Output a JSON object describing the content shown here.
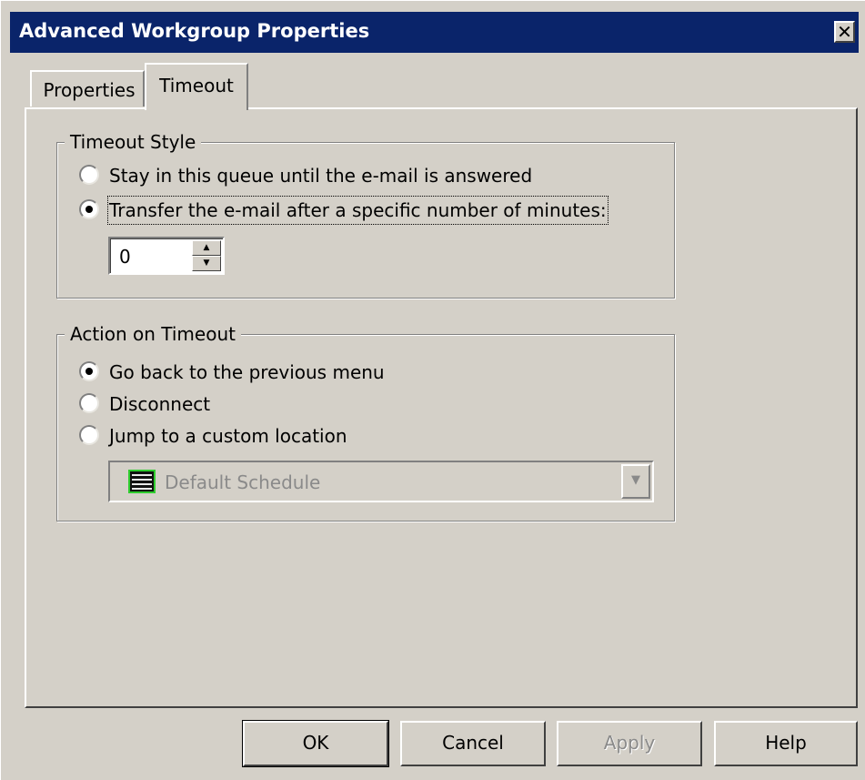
{
  "window": {
    "title": "Advanced Workgroup Properties",
    "close_glyph": "✕"
  },
  "tabs": [
    {
      "label": "Properties",
      "selected": false
    },
    {
      "label": "Timeout",
      "selected": true
    }
  ],
  "timeout_style": {
    "legend": "Timeout Style",
    "options": [
      {
        "label": "Stay in this queue until the e-mail is answered",
        "checked": false
      },
      {
        "label": "Transfer the e-mail after a specific number of minutes:",
        "checked": true
      }
    ],
    "minutes_value": "0"
  },
  "action_on_timeout": {
    "legend": "Action on Timeout",
    "options": [
      {
        "label": "Go back to the previous menu",
        "checked": true
      },
      {
        "label": "Disconnect",
        "checked": false
      },
      {
        "label": "Jump to a custom location",
        "checked": false
      }
    ],
    "location_value": "Default Schedule",
    "location_icon": "schedule-icon"
  },
  "buttons": {
    "ok": "OK",
    "cancel": "Cancel",
    "apply": "Apply",
    "help": "Help"
  },
  "colors": {
    "titlebar": "#0a246a",
    "face": "#d4d0c8",
    "disabled_text": "#8a8a8a"
  }
}
